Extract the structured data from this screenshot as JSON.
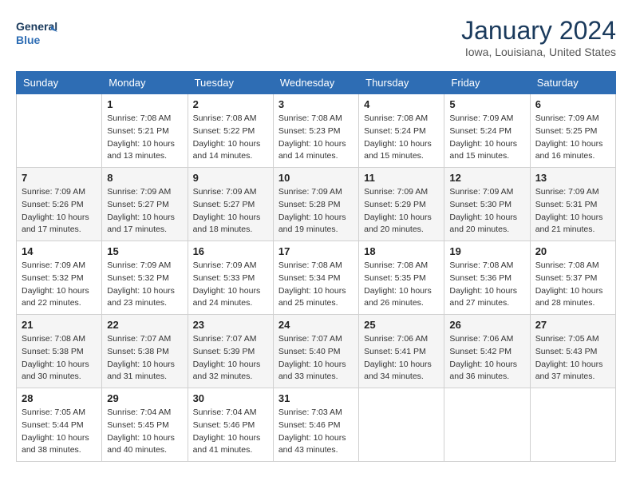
{
  "logo": {
    "line1": "General",
    "line2": "Blue"
  },
  "header": {
    "month_year": "January 2024",
    "location": "Iowa, Louisiana, United States"
  },
  "weekdays": [
    "Sunday",
    "Monday",
    "Tuesday",
    "Wednesday",
    "Thursday",
    "Friday",
    "Saturday"
  ],
  "weeks": [
    [
      {
        "day": "",
        "sunrise": "",
        "sunset": "",
        "daylight": ""
      },
      {
        "day": "1",
        "sunrise": "Sunrise: 7:08 AM",
        "sunset": "Sunset: 5:21 PM",
        "daylight": "Daylight: 10 hours and 13 minutes."
      },
      {
        "day": "2",
        "sunrise": "Sunrise: 7:08 AM",
        "sunset": "Sunset: 5:22 PM",
        "daylight": "Daylight: 10 hours and 14 minutes."
      },
      {
        "day": "3",
        "sunrise": "Sunrise: 7:08 AM",
        "sunset": "Sunset: 5:23 PM",
        "daylight": "Daylight: 10 hours and 14 minutes."
      },
      {
        "day": "4",
        "sunrise": "Sunrise: 7:08 AM",
        "sunset": "Sunset: 5:24 PM",
        "daylight": "Daylight: 10 hours and 15 minutes."
      },
      {
        "day": "5",
        "sunrise": "Sunrise: 7:09 AM",
        "sunset": "Sunset: 5:24 PM",
        "daylight": "Daylight: 10 hours and 15 minutes."
      },
      {
        "day": "6",
        "sunrise": "Sunrise: 7:09 AM",
        "sunset": "Sunset: 5:25 PM",
        "daylight": "Daylight: 10 hours and 16 minutes."
      }
    ],
    [
      {
        "day": "7",
        "sunrise": "Sunrise: 7:09 AM",
        "sunset": "Sunset: 5:26 PM",
        "daylight": "Daylight: 10 hours and 17 minutes."
      },
      {
        "day": "8",
        "sunrise": "Sunrise: 7:09 AM",
        "sunset": "Sunset: 5:27 PM",
        "daylight": "Daylight: 10 hours and 17 minutes."
      },
      {
        "day": "9",
        "sunrise": "Sunrise: 7:09 AM",
        "sunset": "Sunset: 5:27 PM",
        "daylight": "Daylight: 10 hours and 18 minutes."
      },
      {
        "day": "10",
        "sunrise": "Sunrise: 7:09 AM",
        "sunset": "Sunset: 5:28 PM",
        "daylight": "Daylight: 10 hours and 19 minutes."
      },
      {
        "day": "11",
        "sunrise": "Sunrise: 7:09 AM",
        "sunset": "Sunset: 5:29 PM",
        "daylight": "Daylight: 10 hours and 20 minutes."
      },
      {
        "day": "12",
        "sunrise": "Sunrise: 7:09 AM",
        "sunset": "Sunset: 5:30 PM",
        "daylight": "Daylight: 10 hours and 20 minutes."
      },
      {
        "day": "13",
        "sunrise": "Sunrise: 7:09 AM",
        "sunset": "Sunset: 5:31 PM",
        "daylight": "Daylight: 10 hours and 21 minutes."
      }
    ],
    [
      {
        "day": "14",
        "sunrise": "Sunrise: 7:09 AM",
        "sunset": "Sunset: 5:32 PM",
        "daylight": "Daylight: 10 hours and 22 minutes."
      },
      {
        "day": "15",
        "sunrise": "Sunrise: 7:09 AM",
        "sunset": "Sunset: 5:32 PM",
        "daylight": "Daylight: 10 hours and 23 minutes."
      },
      {
        "day": "16",
        "sunrise": "Sunrise: 7:09 AM",
        "sunset": "Sunset: 5:33 PM",
        "daylight": "Daylight: 10 hours and 24 minutes."
      },
      {
        "day": "17",
        "sunrise": "Sunrise: 7:08 AM",
        "sunset": "Sunset: 5:34 PM",
        "daylight": "Daylight: 10 hours and 25 minutes."
      },
      {
        "day": "18",
        "sunrise": "Sunrise: 7:08 AM",
        "sunset": "Sunset: 5:35 PM",
        "daylight": "Daylight: 10 hours and 26 minutes."
      },
      {
        "day": "19",
        "sunrise": "Sunrise: 7:08 AM",
        "sunset": "Sunset: 5:36 PM",
        "daylight": "Daylight: 10 hours and 27 minutes."
      },
      {
        "day": "20",
        "sunrise": "Sunrise: 7:08 AM",
        "sunset": "Sunset: 5:37 PM",
        "daylight": "Daylight: 10 hours and 28 minutes."
      }
    ],
    [
      {
        "day": "21",
        "sunrise": "Sunrise: 7:08 AM",
        "sunset": "Sunset: 5:38 PM",
        "daylight": "Daylight: 10 hours and 30 minutes."
      },
      {
        "day": "22",
        "sunrise": "Sunrise: 7:07 AM",
        "sunset": "Sunset: 5:38 PM",
        "daylight": "Daylight: 10 hours and 31 minutes."
      },
      {
        "day": "23",
        "sunrise": "Sunrise: 7:07 AM",
        "sunset": "Sunset: 5:39 PM",
        "daylight": "Daylight: 10 hours and 32 minutes."
      },
      {
        "day": "24",
        "sunrise": "Sunrise: 7:07 AM",
        "sunset": "Sunset: 5:40 PM",
        "daylight": "Daylight: 10 hours and 33 minutes."
      },
      {
        "day": "25",
        "sunrise": "Sunrise: 7:06 AM",
        "sunset": "Sunset: 5:41 PM",
        "daylight": "Daylight: 10 hours and 34 minutes."
      },
      {
        "day": "26",
        "sunrise": "Sunrise: 7:06 AM",
        "sunset": "Sunset: 5:42 PM",
        "daylight": "Daylight: 10 hours and 36 minutes."
      },
      {
        "day": "27",
        "sunrise": "Sunrise: 7:05 AM",
        "sunset": "Sunset: 5:43 PM",
        "daylight": "Daylight: 10 hours and 37 minutes."
      }
    ],
    [
      {
        "day": "28",
        "sunrise": "Sunrise: 7:05 AM",
        "sunset": "Sunset: 5:44 PM",
        "daylight": "Daylight: 10 hours and 38 minutes."
      },
      {
        "day": "29",
        "sunrise": "Sunrise: 7:04 AM",
        "sunset": "Sunset: 5:45 PM",
        "daylight": "Daylight: 10 hours and 40 minutes."
      },
      {
        "day": "30",
        "sunrise": "Sunrise: 7:04 AM",
        "sunset": "Sunset: 5:46 PM",
        "daylight": "Daylight: 10 hours and 41 minutes."
      },
      {
        "day": "31",
        "sunrise": "Sunrise: 7:03 AM",
        "sunset": "Sunset: 5:46 PM",
        "daylight": "Daylight: 10 hours and 43 minutes."
      },
      {
        "day": "",
        "sunrise": "",
        "sunset": "",
        "daylight": ""
      },
      {
        "day": "",
        "sunrise": "",
        "sunset": "",
        "daylight": ""
      },
      {
        "day": "",
        "sunrise": "",
        "sunset": "",
        "daylight": ""
      }
    ]
  ]
}
